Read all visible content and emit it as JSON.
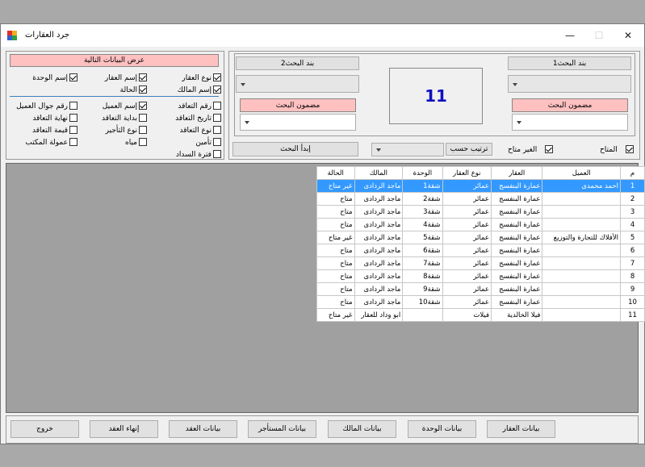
{
  "window": {
    "title": "جرد العقارات"
  },
  "search1": {
    "header": "بند البحث1",
    "content_label": "مضمون البحث"
  },
  "search2": {
    "header": "بند البحث2",
    "content_label": "مضمون البحث"
  },
  "result_count": "11",
  "filters": {
    "available": "المتاح",
    "unavailable": "الغير متاح",
    "sort_by": "ترتيب حسب",
    "start_search": "إبدأ البحث"
  },
  "display": {
    "header": "عرض البيانات التالية",
    "options": [
      {
        "label": "نوع العقار",
        "checked": true
      },
      {
        "label": "إسم العقار",
        "checked": true
      },
      {
        "label": "إسم الوحدة",
        "checked": true
      },
      {
        "label": "إسم المالك",
        "checked": true
      },
      {
        "label": "الحالة",
        "checked": true
      },
      {
        "label": "رقم التعاقد",
        "checked": false
      },
      {
        "label": "إسم العميل",
        "checked": true
      },
      {
        "label": "رقم جوال العميل",
        "checked": false
      },
      {
        "label": "تاريخ التعاقد",
        "checked": false
      },
      {
        "label": "بداية التعاقد",
        "checked": false
      },
      {
        "label": "نهاية التعاقد",
        "checked": false
      },
      {
        "label": "نوع التعاقد",
        "checked": false
      },
      {
        "label": "نوع التأجير",
        "checked": false
      },
      {
        "label": "قيمة التعاقد",
        "checked": false
      },
      {
        "label": "تأمين",
        "checked": false
      },
      {
        "label": "مياه",
        "checked": false
      },
      {
        "label": "عمولة المكتب",
        "checked": false
      },
      {
        "label": "فترة السداد",
        "checked": false
      }
    ]
  },
  "table": {
    "columns": [
      "م",
      "العميل",
      "العقار",
      "نوع العقار",
      "الوحدة",
      "المالك",
      "الحالة"
    ],
    "rows": [
      [
        "1",
        "احمد محمدى",
        "عمارة البنفسج",
        "عمائر",
        "شقة1",
        "ماجد الردادى",
        "غير متاح"
      ],
      [
        "2",
        "",
        "عمارة البنفسج",
        "عمائر",
        "شقة2",
        "ماجد الردادى",
        "متاح"
      ],
      [
        "3",
        "",
        "عمارة البنفسج",
        "عمائر",
        "شقة3",
        "ماجد الردادى",
        "متاح"
      ],
      [
        "4",
        "",
        "عمارة البنفسج",
        "عمائر",
        "شقة4",
        "ماجد الردادى",
        "متاح"
      ],
      [
        "5",
        "الأفلاك للتجارة والتوزيع",
        "عمارة البنفسج",
        "عمائر",
        "شقة5",
        "ماجد الردادى",
        "غير متاح"
      ],
      [
        "6",
        "",
        "عمارة البنفسج",
        "عمائر",
        "شقة6",
        "ماجد الردادى",
        "متاح"
      ],
      [
        "7",
        "",
        "عمارة البنفسج",
        "عمائر",
        "شقة7",
        "ماجد الردادى",
        "متاح"
      ],
      [
        "8",
        "",
        "عمارة البنفسج",
        "عمائر",
        "شقة8",
        "ماجد الردادى",
        "متاح"
      ],
      [
        "9",
        "",
        "عمارة البنفسج",
        "عمائر",
        "شقة9",
        "ماجد الردادى",
        "متاح"
      ],
      [
        "10",
        "",
        "عمارة البنفسج",
        "عمائر",
        "شقة10",
        "ماجد الردادى",
        "متاح"
      ],
      [
        "11",
        "",
        "فيلا الخالدية",
        "فيلات",
        "",
        "ابو وداد للعقار",
        "غير متاح"
      ]
    ]
  },
  "buttons": [
    "بيانات العقار",
    "بيانات الوحدة",
    "بيانات المالك",
    "بيانات المستأجر",
    "بيانات العقد",
    "إنهاء العقد",
    "خروج"
  ]
}
